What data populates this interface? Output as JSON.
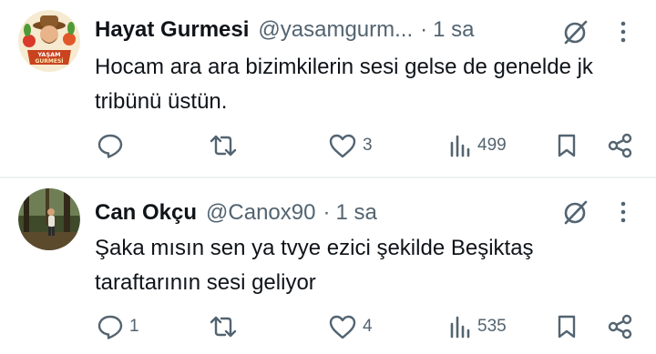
{
  "tweets": [
    {
      "author": {
        "name": "Hayat Gurmesi",
        "handle": "@yasamgurm...",
        "avatar_label_top": "YAŞAM",
        "avatar_label_bottom": "GURMESİ"
      },
      "separator": "·",
      "time": "1 sa",
      "text": "Hocam ara ara bizimkilerin sesi gelse de genelde jk tribünü üstün.",
      "stats": {
        "replies": "",
        "reposts": "",
        "likes": "3",
        "views": "499"
      }
    },
    {
      "author": {
        "name": "Can Okçu",
        "handle": "@Canox90"
      },
      "separator": "·",
      "time": "1 sa",
      "text": "Şaka mısın sen ya tvye ezici şekilde Beşiktaş taraftarının sesi geliyor",
      "stats": {
        "replies": "1",
        "reposts": "",
        "likes": "4",
        "views": "535"
      }
    }
  ],
  "colors": {
    "text_primary": "#0f1419",
    "text_secondary": "#536471",
    "divider": "#eff3f4"
  },
  "icons": [
    "grok-icon",
    "more-icon",
    "reply-icon",
    "repost-icon",
    "like-icon",
    "views-icon",
    "bookmark-icon",
    "share-icon"
  ]
}
